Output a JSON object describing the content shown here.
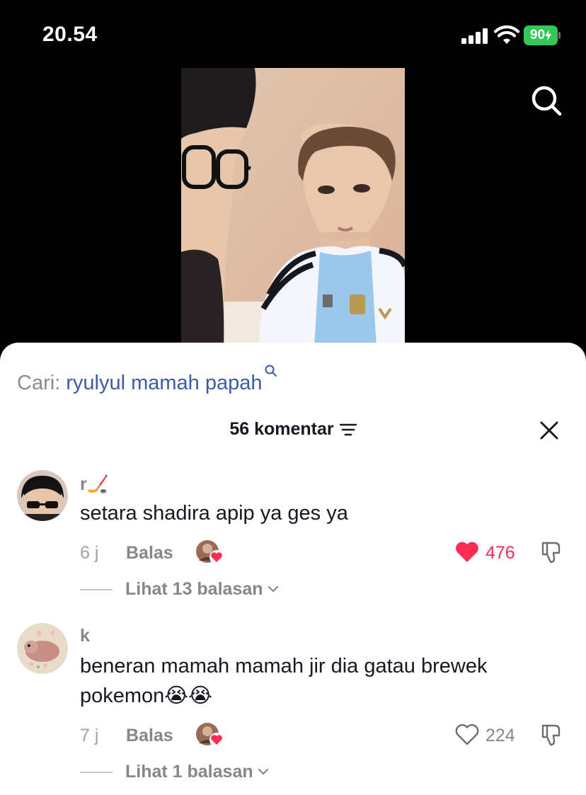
{
  "status_bar": {
    "time": "20.54",
    "battery": "90"
  },
  "search_bar": {
    "prefix": "Cari:",
    "query": "ryulyul mamah papah"
  },
  "comments_header": {
    "title": "56 komentar"
  },
  "comments": [
    {
      "username": "r🏒",
      "text": "setara shadira apip ya ges ya",
      "time": "6 j",
      "reply_label": "Balas",
      "likes": "476",
      "liked": true,
      "view_replies": "Lihat 13 balasan"
    },
    {
      "username": "k",
      "text": "beneran mamah mamah jir dia gatau brewek pokemon😭😭",
      "time": "7 j",
      "reply_label": "Balas",
      "likes": "224",
      "liked": false,
      "view_replies": "Lihat 1 balasan"
    }
  ],
  "colors": {
    "accent_link": "#3d5ba9",
    "like_red": "#fe2c55",
    "battery_green": "#34c759"
  }
}
